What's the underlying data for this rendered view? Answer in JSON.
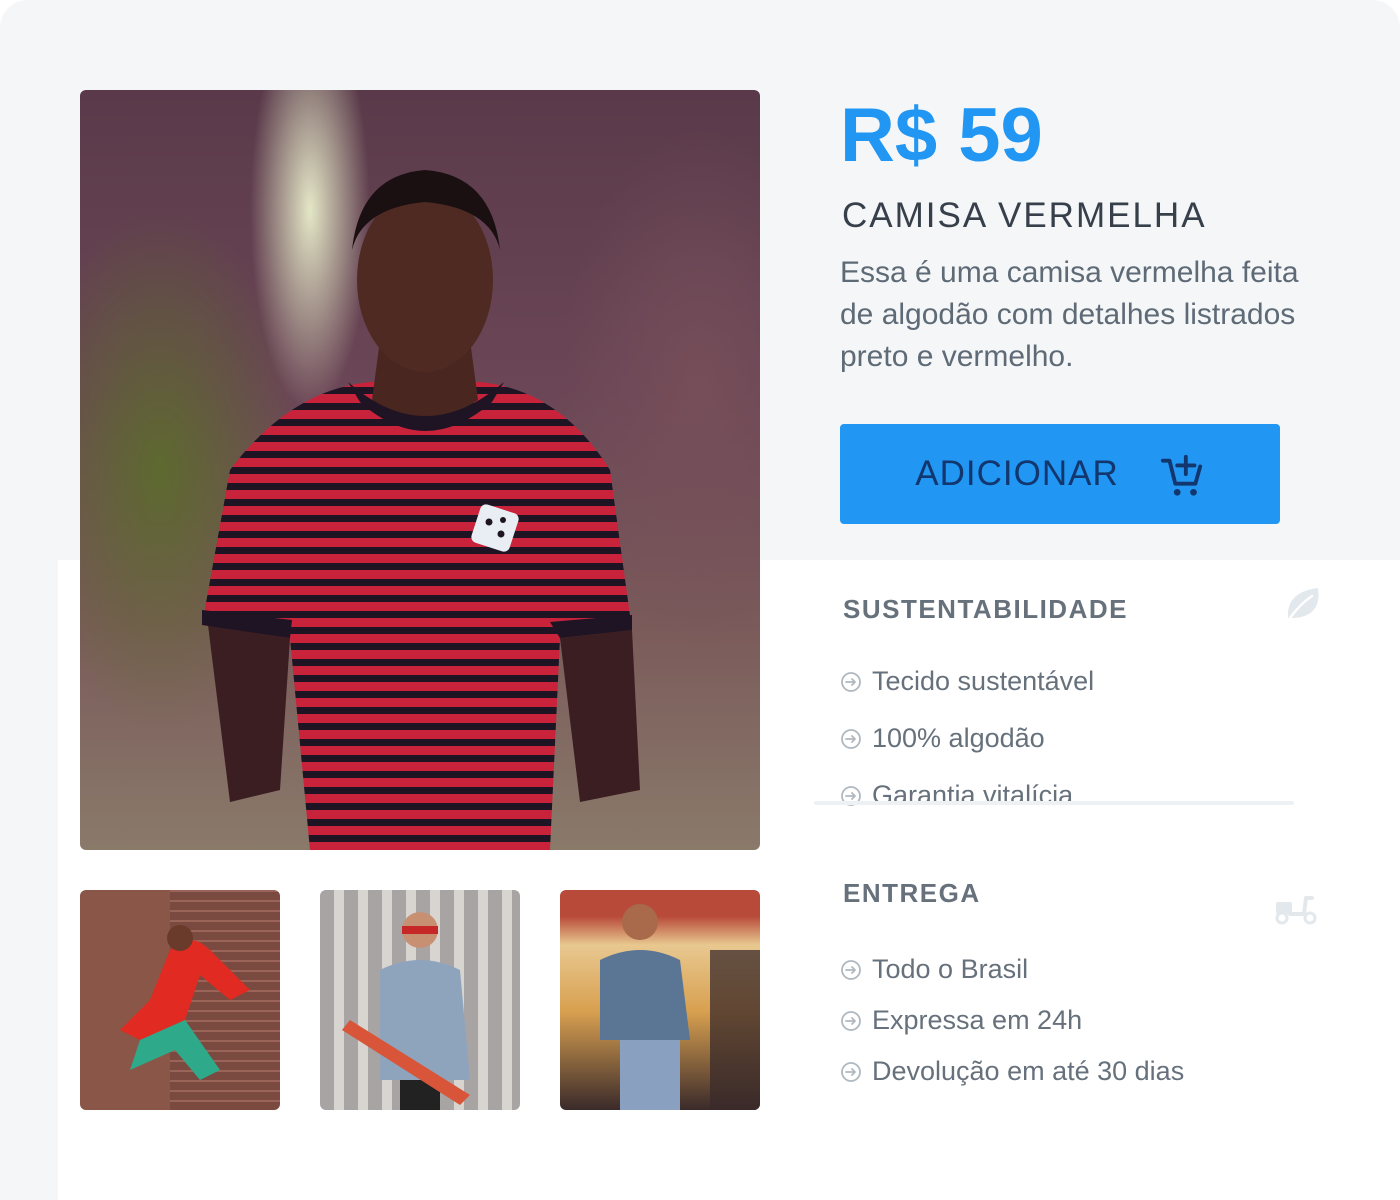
{
  "product": {
    "price": "R$ 59",
    "name": "CAMISA VERMELHA",
    "description": "Essa é uma camisa vermelha feita de algodão com detalhes listrados preto e vermelho.",
    "add_button_label": "ADICIONAR",
    "add_button_icon": "add-to-cart-icon"
  },
  "gallery": {
    "main_image": "man-in-red-striped-shirt",
    "thumbnails": [
      "man-climbing-brick-wall",
      "man-with-skateboard",
      "man-in-denim-jacket"
    ]
  },
  "sustainability": {
    "title": "SUSTENTABILIDADE",
    "icon": "leaf-icon",
    "items": [
      "Tecido sustentável",
      "100% algodão",
      "Garantia vitalícia"
    ]
  },
  "delivery": {
    "title": "ENTREGA",
    "icon": "scooter-icon",
    "items": [
      "Todo o Brasil",
      "Expressa em 24h",
      "Devolução em até 30 dias"
    ]
  },
  "colors": {
    "accent": "#2196f3",
    "button_text": "#12376e",
    "heading": "#37404a",
    "body_text": "#5e6a76",
    "background": "#f4f6f8"
  }
}
